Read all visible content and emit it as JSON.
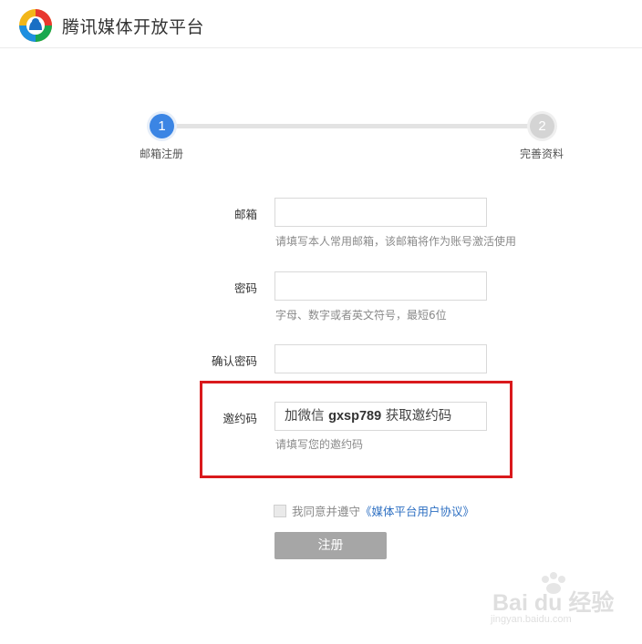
{
  "header": {
    "title": "腾讯媒体开放平台",
    "logo_icon": "tencent-media-logo"
  },
  "steps": [
    {
      "number": "1",
      "label": "邮箱注册",
      "state": "active"
    },
    {
      "number": "2",
      "label": "完善资料",
      "state": "inactive"
    }
  ],
  "form": {
    "email": {
      "label": "邮箱",
      "value": "",
      "hint": "请填写本人常用邮箱，该邮箱将作为账号激活使用"
    },
    "password": {
      "label": "密码",
      "value": "",
      "hint": "字母、数字或者英文符号，最短6位"
    },
    "confirm": {
      "label": "确认密码",
      "value": ""
    },
    "invite": {
      "label": "邀约码",
      "value_prefix": "加微信 ",
      "value_bold": "gxsp789",
      "value_suffix": " 获取邀约码",
      "hint": "请填写您的邀约码"
    },
    "agree": {
      "text": "我同意并遵守",
      "link": "《媒体平台用户协议》",
      "checked": false
    },
    "submit_label": "注册"
  },
  "watermark": {
    "text": "Bai du 经验",
    "sub": "jingyan.baidu.com"
  },
  "colors": {
    "accent": "#3b85e4",
    "highlight": "#d9191c",
    "button": "#a6a6a6",
    "link": "#2d6fc2"
  }
}
